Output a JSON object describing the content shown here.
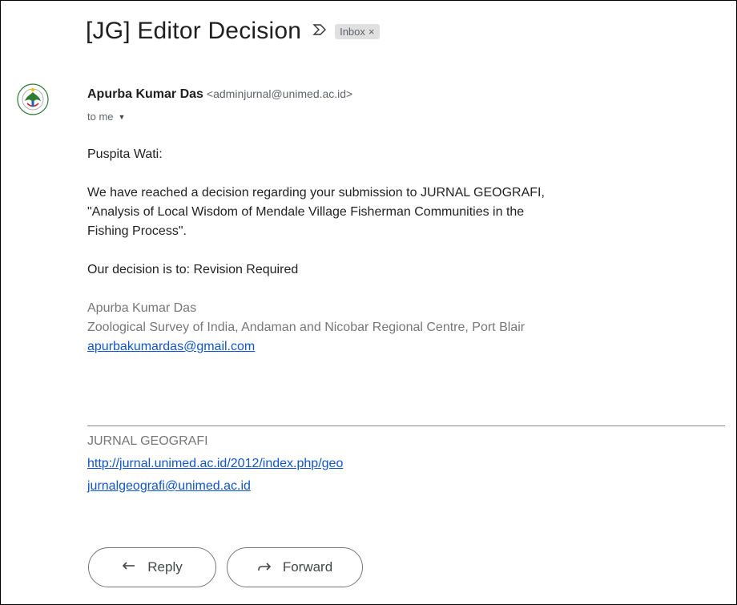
{
  "email": {
    "subject": "[JG] Editor Decision",
    "importance_symbol": "ᐅ",
    "label": "Inbox",
    "label_remove": "×",
    "sender_name": "Apurba Kumar Das",
    "sender_email": "<adminjurnal@unimed.ac.id>",
    "recipient": "to me",
    "avatar_icon": "university-seal-icon"
  },
  "body": {
    "greeting": "Puspita Wati:",
    "paragraph1_line1": "We have reached a decision regarding your submission to JURNAL GEOGRAFI,",
    "paragraph1_line2": "\"Analysis of Local Wisdom of Mendale Village Fisherman Communities in the",
    "paragraph1_line3": "Fishing Process\".",
    "decision": "Our decision is to: Revision Required"
  },
  "signature": {
    "name": "Apurba Kumar Das",
    "affiliation": "Zoological Survey of India, Andaman and Nicobar Regional Centre, Port Blair",
    "email": "apurbakumardas@gmail.com"
  },
  "footer": {
    "journal": "JURNAL GEOGRAFI",
    "url": "http://jurnal.unimed.ac.id/2012/index.php/geo",
    "email": "jurnalgeografi@unimed.ac.id"
  },
  "actions": {
    "reply_label": "Reply",
    "forward_label": "Forward"
  },
  "colors": {
    "link": "#1155cc",
    "signature_text": "#777777"
  }
}
